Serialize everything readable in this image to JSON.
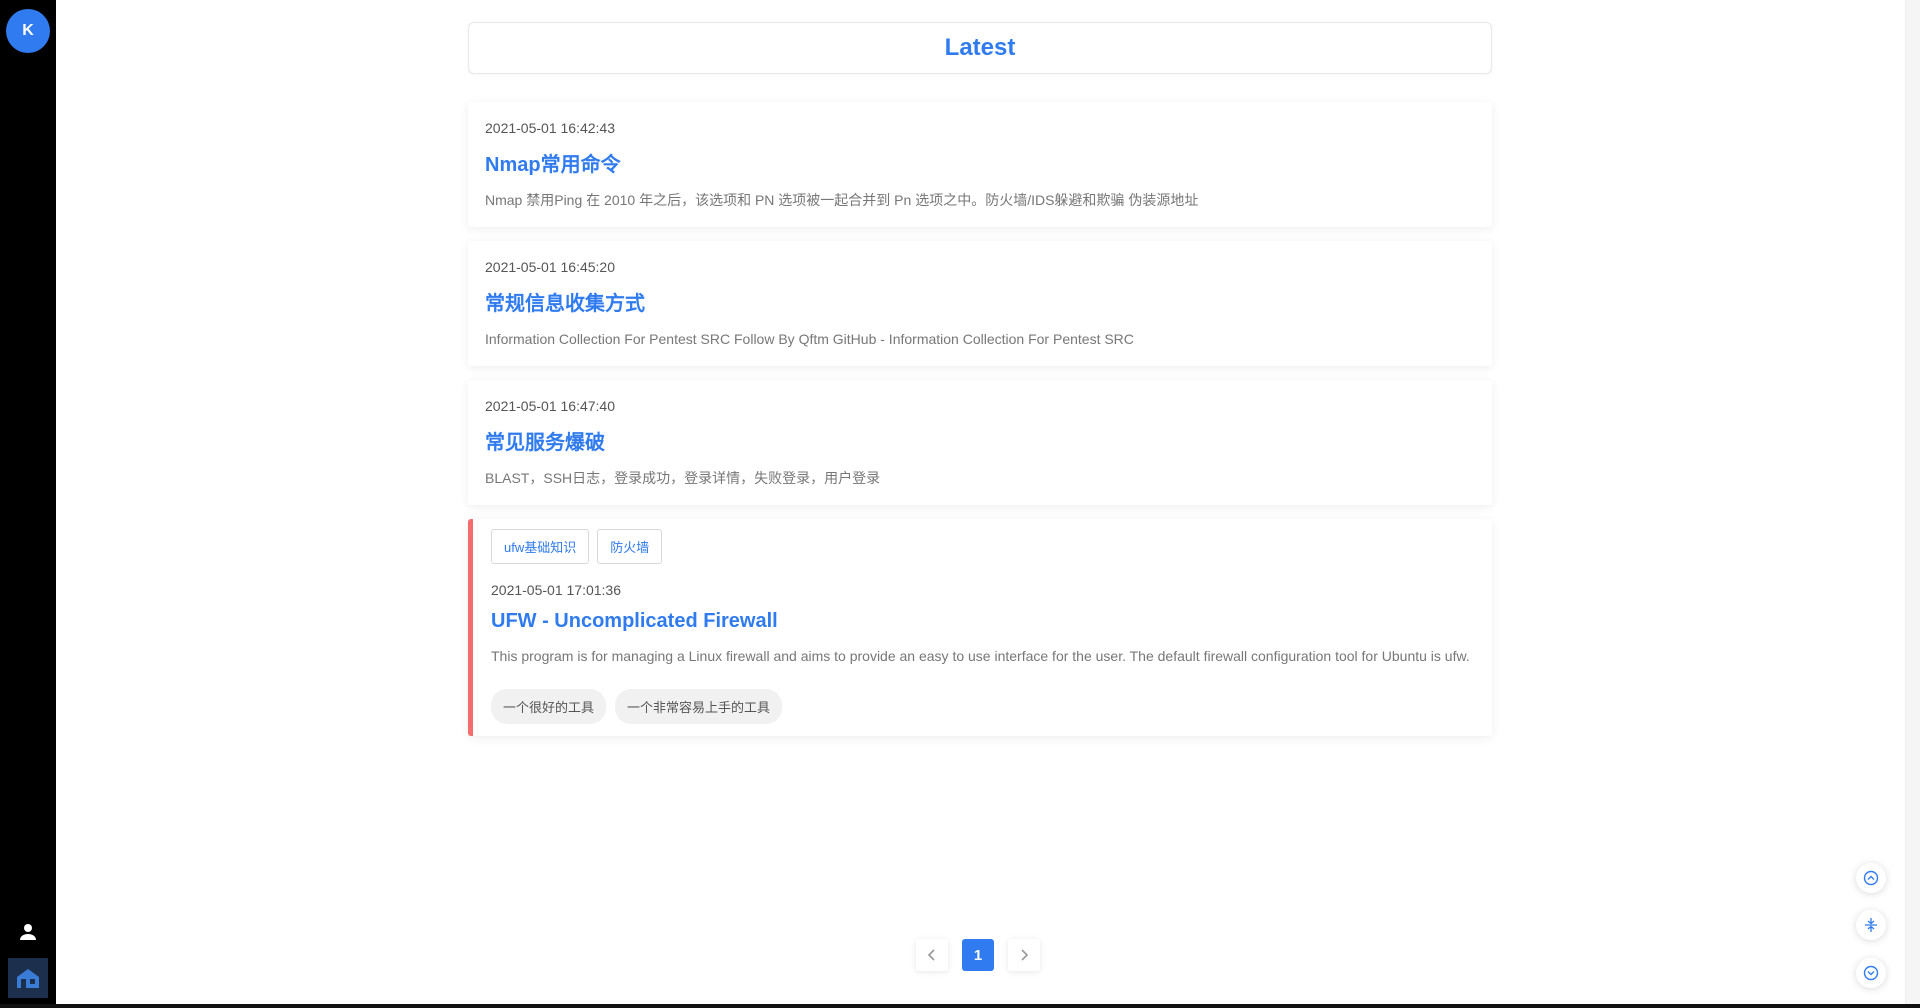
{
  "sidebar": {
    "avatar_letter": "K",
    "items": [
      {
        "icon": "user-icon"
      },
      {
        "icon": "home-icon"
      }
    ]
  },
  "main": {
    "heading": "Latest",
    "posts": [
      {
        "date": "2021-05-01 16:42:43",
        "title": "Nmap常用命令",
        "summary": "Nmap 禁用Ping 在 2010 年之后，该选项和 PN 选项被一起合并到 Pn 选项之中。防火墙/IDS躲避和欺骗 伪装源地址"
      },
      {
        "date": "2021-05-01 16:45:20",
        "title": "常规信息收集方式",
        "summary": "Information Collection For Pentest SRC Follow By Qftm GitHub - Information Collection For Pentest SRC"
      },
      {
        "date": "2021-05-01 16:47:40",
        "title": "常见服务爆破",
        "summary": "BLAST，SSH日志，登录成功，登录详情，失败登录，用户登录"
      },
      {
        "tags": [
          "ufw基础知识",
          "防火墙"
        ],
        "date": "2021-05-01 17:01:36",
        "title": "UFW - Uncomplicated Firewall",
        "summary": "This program is for managing a Linux firewall and aims to provide an easy to use interface for the user. The default firewall configuration tool for Ubuntu is ufw.",
        "chips": [
          "一个很好的工具",
          "一个非常容易上手的工具"
        ]
      }
    ]
  },
  "pagination": {
    "prev_icon": "chevron-left-icon",
    "current": "1",
    "next_icon": "chevron-right-icon"
  },
  "float_buttons": [
    "scroll-top-icon",
    "collapse-icon",
    "scroll-bottom-icon"
  ],
  "colors": {
    "accent": "#2f7bef",
    "sidebar_bg": "#000000",
    "sticky_border": "#f56c6c"
  }
}
